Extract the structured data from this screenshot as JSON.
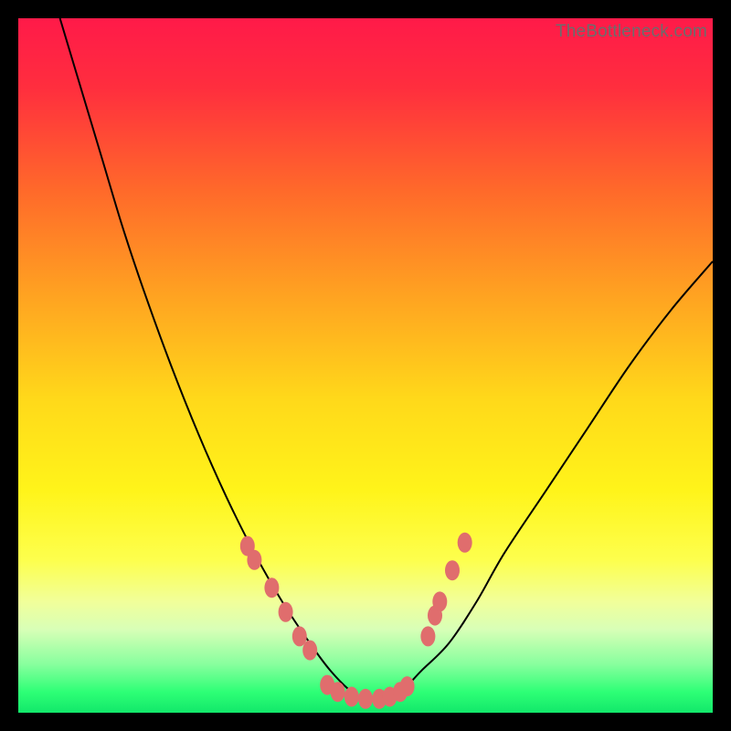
{
  "watermark": "TheBottleneck.com",
  "chart_data": {
    "type": "line",
    "title": "",
    "xlabel": "",
    "ylabel": "",
    "xlim": [
      0,
      100
    ],
    "ylim": [
      0,
      100
    ],
    "background_gradient": {
      "stops": [
        {
          "y": 0,
          "color": "#ff1a49"
        },
        {
          "y": 10,
          "color": "#ff2e3e"
        },
        {
          "y": 25,
          "color": "#ff6a2a"
        },
        {
          "y": 40,
          "color": "#ffa321"
        },
        {
          "y": 55,
          "color": "#ffd91a"
        },
        {
          "y": 68,
          "color": "#fff41a"
        },
        {
          "y": 78,
          "color": "#fdff4d"
        },
        {
          "y": 84,
          "color": "#f1ff9a"
        },
        {
          "y": 88,
          "color": "#d8ffb7"
        },
        {
          "y": 93,
          "color": "#88ff9e"
        },
        {
          "y": 97,
          "color": "#2eff76"
        },
        {
          "y": 100,
          "color": "#12e86a"
        }
      ]
    },
    "series": [
      {
        "name": "bottleneck-curve",
        "type": "line",
        "color": "#000000",
        "x": [
          6,
          9,
          12,
          15,
          18,
          22,
          26,
          30,
          34,
          38,
          42,
          45,
          48,
          50,
          52,
          55,
          58,
          62,
          66,
          70,
          76,
          82,
          88,
          94,
          100
        ],
        "values": [
          100,
          90,
          80,
          70,
          61,
          50,
          40,
          31,
          23,
          16,
          10,
          6,
          3,
          2,
          2,
          3,
          6,
          10,
          16,
          23,
          32,
          41,
          50,
          58,
          65
        ]
      },
      {
        "name": "left-markers",
        "type": "scatter",
        "color": "#e06d6d",
        "x": [
          33.0,
          34.0,
          36.5,
          38.5,
          40.5,
          42.0
        ],
        "values": [
          24.0,
          22.0,
          18.0,
          14.5,
          11.0,
          9.0
        ]
      },
      {
        "name": "right-markers",
        "type": "scatter",
        "color": "#e06d6d",
        "x": [
          59.0,
          60.0,
          60.7,
          62.5,
          64.3
        ],
        "values": [
          11.0,
          14.0,
          16.0,
          20.5,
          24.5
        ]
      },
      {
        "name": "bottom-markers",
        "type": "scatter",
        "color": "#e06d6d",
        "x": [
          44.5,
          46.0,
          48.0,
          50.0,
          52.0,
          53.5,
          55.0,
          56.0
        ],
        "values": [
          4.0,
          3.0,
          2.3,
          2.0,
          2.0,
          2.3,
          3.0,
          3.8
        ]
      }
    ]
  }
}
